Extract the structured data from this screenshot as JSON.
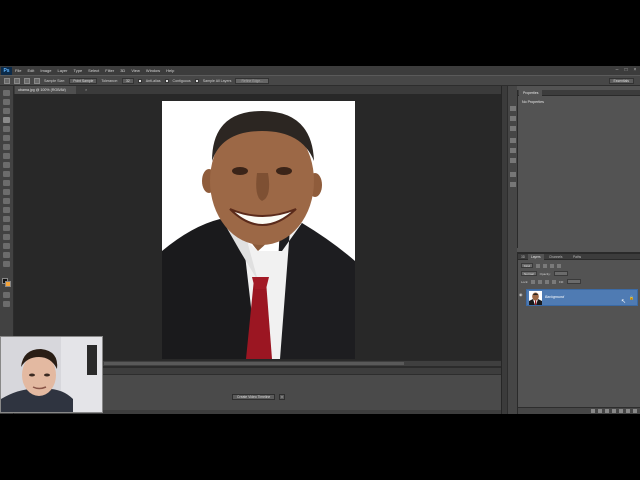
{
  "app": {
    "logo": "Ps",
    "menu": [
      "File",
      "Edit",
      "Image",
      "Layer",
      "Type",
      "Select",
      "Filter",
      "3D",
      "View",
      "Window",
      "Help"
    ],
    "window_controls": [
      "–",
      "□",
      "×"
    ]
  },
  "options_bar": {
    "sample_size_label": "Sample Size:",
    "sample_size_value": "Point Sample",
    "tolerance_label": "Tolerance:",
    "tolerance_value": "32",
    "anti_alias_label": "Anti-alias",
    "contiguous_label": "Contiguous",
    "sample_all_label": "Sample All Layers",
    "refine_edge_label": "Refine Edge...",
    "workspace": "Essentials"
  },
  "document": {
    "tab_title": "obama.jpg @ 100% (RGB/8#)",
    "close_glyph": "×"
  },
  "timeline": {
    "create_button": "Create Video Timeline"
  },
  "properties": {
    "tab": "Properties",
    "empty_label": "No Properties"
  },
  "layers_panel": {
    "tabs": [
      "Layers",
      "Channels",
      "Paths"
    ],
    "kind_filter": "Kind",
    "blend_mode": "Normal",
    "opacity_label": "Opacity:",
    "lock_label": "Lock:",
    "fill_label": "Fill:",
    "layer_name": "Background",
    "lock_glyph": "🔒",
    "eye_glyph": "◉"
  },
  "colors": {
    "foreground": "#111111",
    "background": "#f5a43a",
    "selected_layer": "#4f7bb3",
    "canvas_bg": "#282828"
  }
}
